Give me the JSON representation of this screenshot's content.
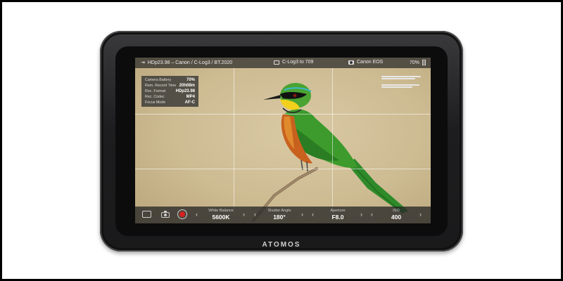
{
  "brand": "ATOMOS",
  "topbar": {
    "input_label": "HDp23.98 – Canon / C-Log3 / BT.2020",
    "lut_label": "C-Log3 to 709",
    "camera_label": "Canon EOS",
    "battery_label": "70%"
  },
  "info_panel": {
    "rows": [
      {
        "label": "Camera Battery",
        "value": "70%"
      },
      {
        "label": "Rem. Record Time",
        "value": "20h08m"
      },
      {
        "label": "Rec. Format",
        "value": "HDp23.98"
      },
      {
        "label": "Rec. Codec",
        "value": "MP4"
      },
      {
        "label": "Focus Mode",
        "value": "AF-C"
      }
    ]
  },
  "controls": {
    "white_balance": {
      "label": "White Balance",
      "value": "5600K"
    },
    "shutter_angle": {
      "label": "Shutter Angle",
      "value": "180°"
    },
    "aperture": {
      "label": "Aperture",
      "value": "F8.0"
    },
    "iso": {
      "label": "ISO",
      "value": "400"
    },
    "chevron_left": "‹",
    "chevron_right": "›"
  },
  "colors": {
    "record": "#d32121",
    "screen_bg": "#cdbb92"
  }
}
